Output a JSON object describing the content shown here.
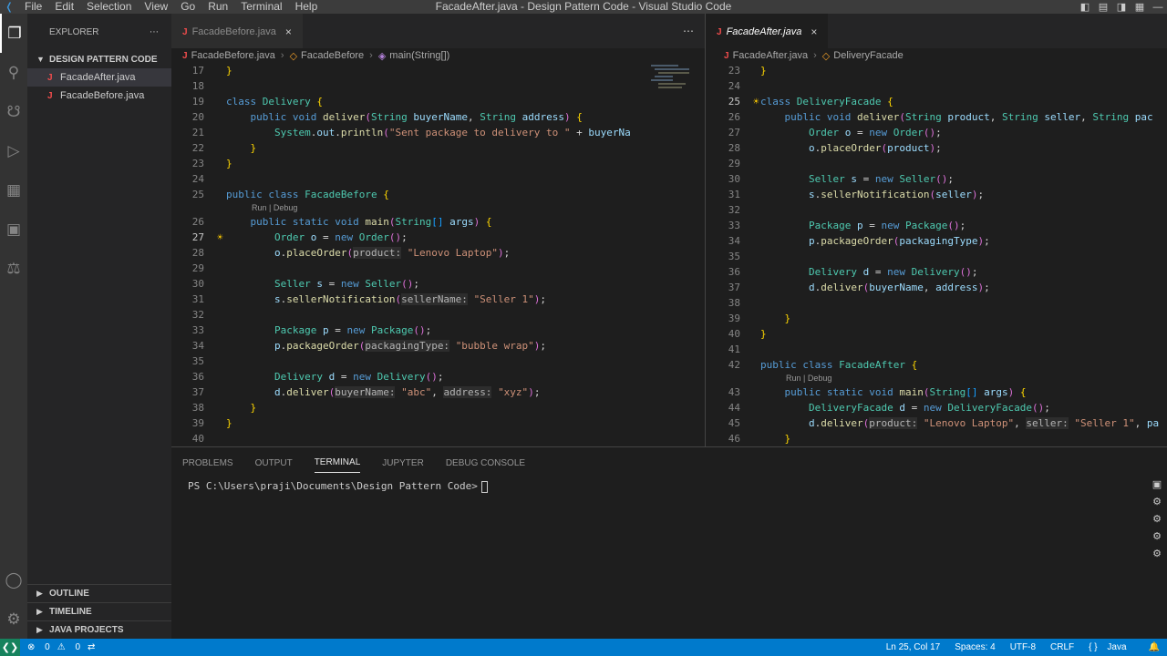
{
  "window": {
    "title": "FacadeAfter.java - Design Pattern Code - Visual Studio Code",
    "menu": [
      "File",
      "Edit",
      "Selection",
      "View",
      "Go",
      "Run",
      "Terminal",
      "Help"
    ]
  },
  "sidebar": {
    "header": "EXPLORER",
    "folder": "DESIGN PATTERN CODE",
    "files": [
      "FacadeAfter.java",
      "FacadeBefore.java"
    ],
    "outline": "OUTLINE",
    "timeline": "TIMELINE",
    "java_projects": "JAVA PROJECTS"
  },
  "left_editor": {
    "tab": "FacadeBefore.java",
    "breadcrumb": [
      "FacadeBefore.java",
      "FacadeBefore",
      "main(String[])"
    ],
    "codelens": "Run | Debug",
    "current_line": 27,
    "lines": [
      {
        "n": 17,
        "t": "}"
      },
      {
        "n": 18,
        "t": ""
      },
      {
        "n": 19,
        "t": "class Delivery {"
      },
      {
        "n": 20,
        "t": "    public void deliver(String buyerName, String address) {"
      },
      {
        "n": 21,
        "t": "        System.out.println(\"Sent package to delivery to \" + buyerNa"
      },
      {
        "n": 22,
        "t": "    }"
      },
      {
        "n": 23,
        "t": "}"
      },
      {
        "n": 24,
        "t": ""
      },
      {
        "n": 25,
        "t": "public class FacadeBefore {"
      },
      {
        "n": 26,
        "t": "    public static void main(String[] args) {"
      },
      {
        "n": 27,
        "t": "        Order o = new Order();"
      },
      {
        "n": 28,
        "t": "        o.placeOrder(product: \"Lenovo Laptop\");"
      },
      {
        "n": 29,
        "t": ""
      },
      {
        "n": 30,
        "t": "        Seller s = new Seller();"
      },
      {
        "n": 31,
        "t": "        s.sellerNotification(sellerName: \"Seller 1\");"
      },
      {
        "n": 32,
        "t": ""
      },
      {
        "n": 33,
        "t": "        Package p = new Package();"
      },
      {
        "n": 34,
        "t": "        p.packageOrder(packagingType: \"bubble wrap\");"
      },
      {
        "n": 35,
        "t": ""
      },
      {
        "n": 36,
        "t": "        Delivery d = new Delivery();"
      },
      {
        "n": 37,
        "t": "        d.deliver(buyerName: \"abc\", address: \"xyz\");"
      },
      {
        "n": 38,
        "t": "    }"
      },
      {
        "n": 39,
        "t": "}"
      },
      {
        "n": 40,
        "t": ""
      }
    ]
  },
  "right_editor": {
    "tab": "FacadeAfter.java",
    "breadcrumb": [
      "FacadeAfter.java",
      "DeliveryFacade"
    ],
    "codelens": "Run | Debug",
    "current_line": 25,
    "lines": [
      {
        "n": 23,
        "t": "}"
      },
      {
        "n": 24,
        "t": ""
      },
      {
        "n": 25,
        "t": "class DeliveryFacade {"
      },
      {
        "n": 26,
        "t": "    public void deliver(String product, String seller, String pac"
      },
      {
        "n": 27,
        "t": "        Order o = new Order();"
      },
      {
        "n": 28,
        "t": "        o.placeOrder(product);"
      },
      {
        "n": 29,
        "t": ""
      },
      {
        "n": 30,
        "t": "        Seller s = new Seller();"
      },
      {
        "n": 31,
        "t": "        s.sellerNotification(seller);"
      },
      {
        "n": 32,
        "t": ""
      },
      {
        "n": 33,
        "t": "        Package p = new Package();"
      },
      {
        "n": 34,
        "t": "        p.packageOrder(packagingType);"
      },
      {
        "n": 35,
        "t": ""
      },
      {
        "n": 36,
        "t": "        Delivery d = new Delivery();"
      },
      {
        "n": 37,
        "t": "        d.deliver(buyerName, address);"
      },
      {
        "n": 38,
        "t": ""
      },
      {
        "n": 39,
        "t": "    }"
      },
      {
        "n": 40,
        "t": "}"
      },
      {
        "n": 41,
        "t": ""
      },
      {
        "n": 42,
        "t": "public class FacadeAfter {"
      },
      {
        "n": 43,
        "t": "    public static void main(String[] args) {"
      },
      {
        "n": 44,
        "t": "        DeliveryFacade d = new DeliveryFacade();"
      },
      {
        "n": 45,
        "t": "        d.deliver(product: \"Lenovo Laptop\", seller: \"Seller 1\", pa"
      },
      {
        "n": 46,
        "t": "    }"
      }
    ]
  },
  "panel": {
    "tabs": [
      "PROBLEMS",
      "OUTPUT",
      "TERMINAL",
      "JUPYTER",
      "DEBUG CONSOLE"
    ],
    "active_tab": "TERMINAL",
    "prompt": "PS C:\\Users\\praji\\Documents\\Design Pattern Code>"
  },
  "status": {
    "errors": "0",
    "warnings": "0",
    "position": "Ln 25, Col 17",
    "spaces": "Spaces: 4",
    "encoding": "UTF-8",
    "eol": "CRLF",
    "language": "Java"
  },
  "colors": {
    "statusbar": "#007acc",
    "editor_bg": "#1e1e1e",
    "sidebar_bg": "#252526",
    "keyword": "#569cd6",
    "type": "#4ec9b0",
    "function": "#dcdcaa",
    "string": "#ce9178"
  }
}
